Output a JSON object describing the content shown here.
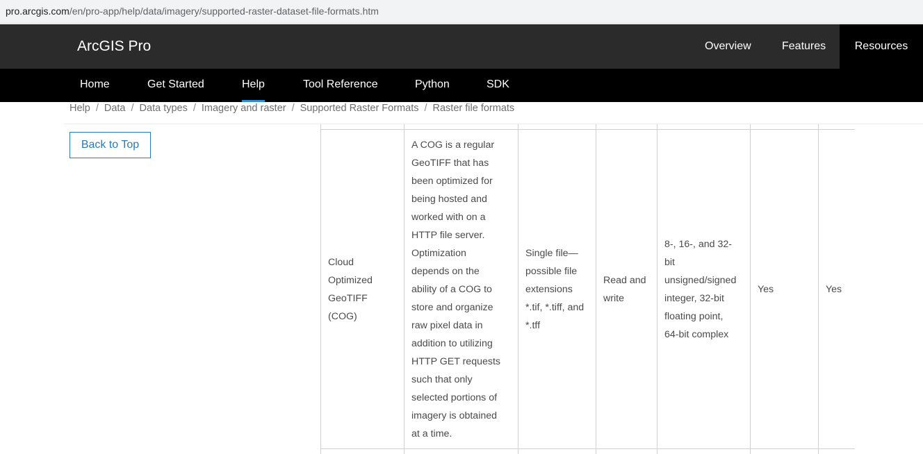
{
  "browser": {
    "url_host": "pro.arcgis.com",
    "url_path": "/en/pro-app/help/data/imagery/supported-raster-dataset-file-formats.htm"
  },
  "header": {
    "title": "ArcGIS Pro",
    "nav": [
      "Overview",
      "Features",
      "Resources"
    ]
  },
  "subnav": {
    "items": [
      "Home",
      "Get Started",
      "Help",
      "Tool Reference",
      "Python",
      "SDK"
    ],
    "active": "Help"
  },
  "breadcrumb": [
    "Help",
    "Data",
    "Data types",
    "Imagery and raster",
    "Supported Raster Formats",
    "Raster file formats"
  ],
  "sidebar": {
    "back_to_top": "Back to Top"
  },
  "table": {
    "row": {
      "format": [
        "Cloud",
        "Optimized",
        "GeoTIFF",
        "(COG)"
      ],
      "description": [
        "A COG is a regular",
        "GeoTIFF that has",
        "been optimized for",
        "being hosted and",
        "worked with on a",
        "HTTP file server.",
        "Optimization",
        "depends on the",
        "ability of a COG to",
        "store and organize",
        "raw pixel data in",
        "addition to utilizing",
        "HTTP GET requests",
        "such that only",
        "selected portions of",
        "imagery is obtained",
        "at a time."
      ],
      "extensions": [
        "Single file—",
        "possible file",
        "extensions",
        "*.tif, *.tiff, and",
        "*.tff"
      ],
      "access": [
        "Read and",
        "write"
      ],
      "data_types": [
        "8-, 16-, and 32-",
        "bit",
        "unsigned/signed",
        "integer, 32-bit",
        "floating point,",
        "64-bit complex"
      ],
      "col6": "Yes",
      "col7": "Yes"
    }
  }
}
